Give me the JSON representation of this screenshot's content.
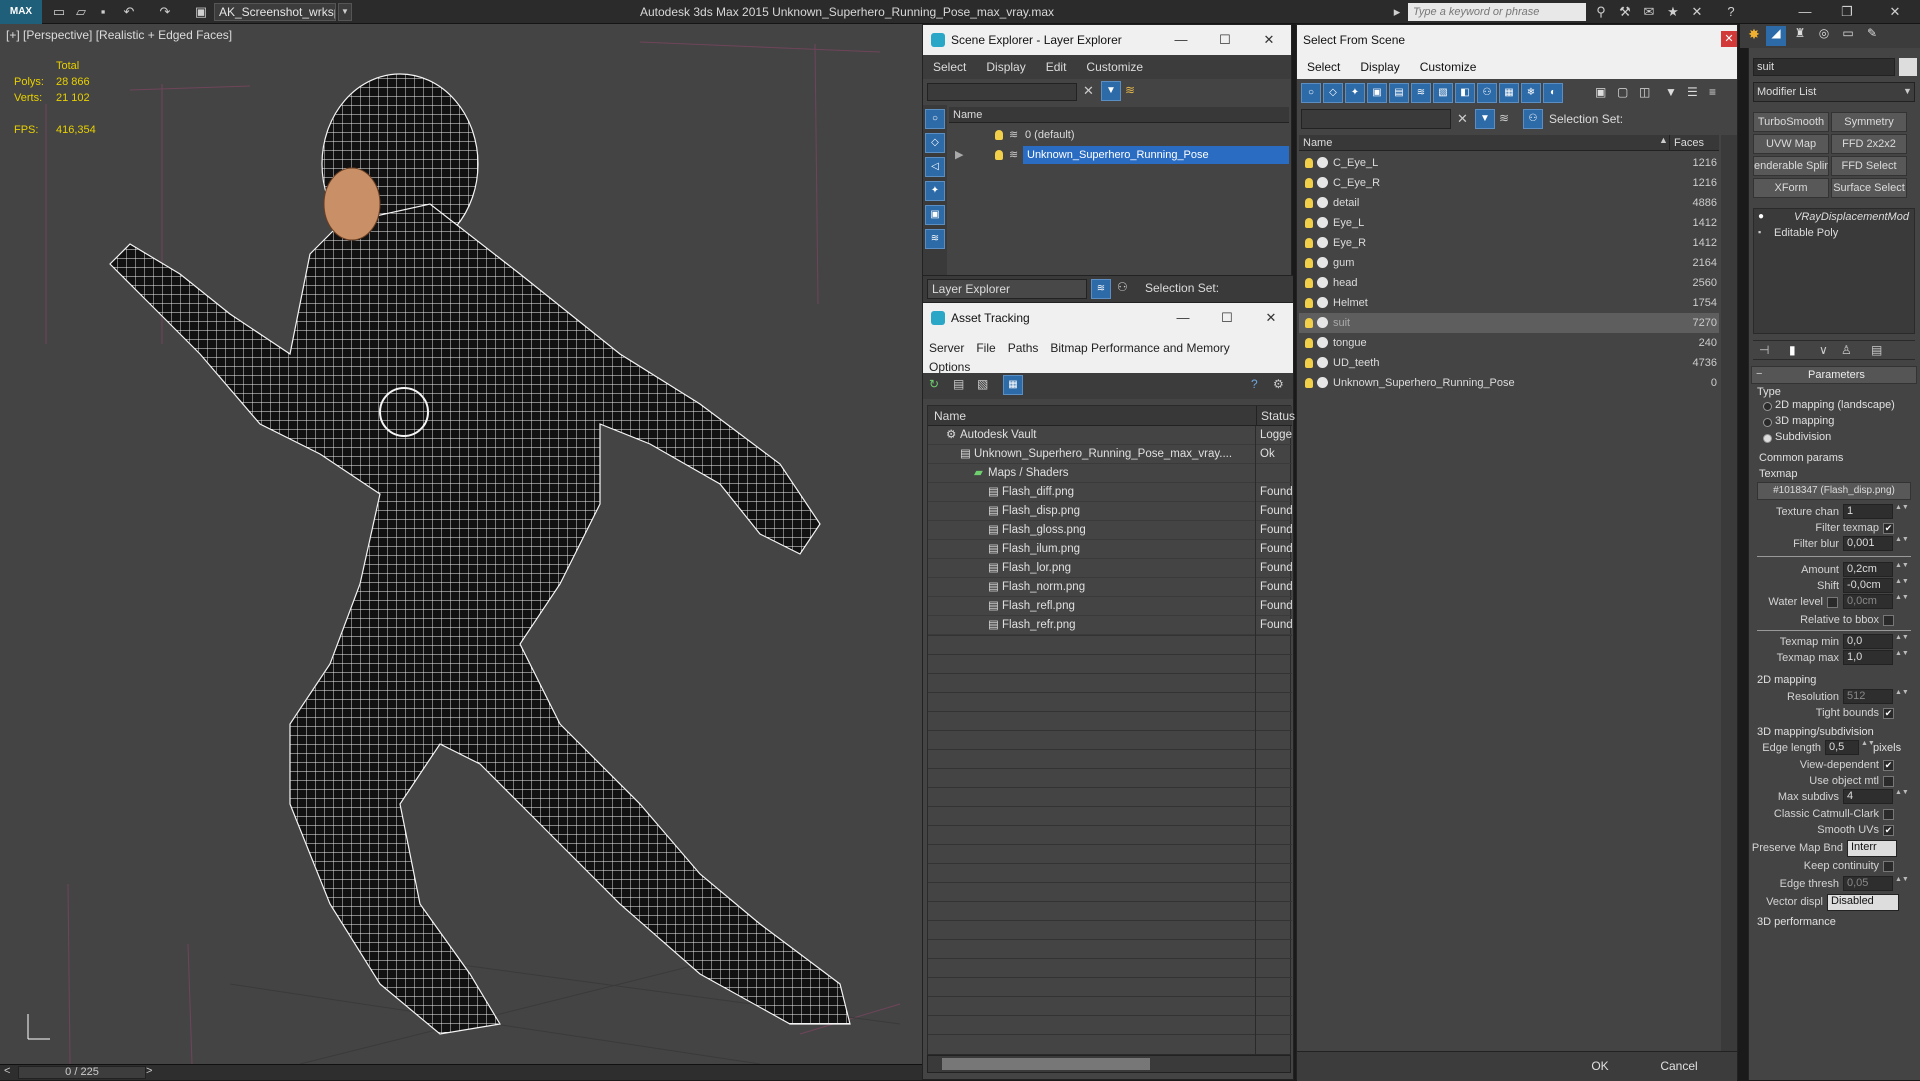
{
  "app": {
    "title": "Autodesk 3ds Max  2015    Unknown_Superhero_Running_Pose_max_vray.max",
    "workspace": "AK_Screenshot_wrksp",
    "search_placeholder": "Type a keyword or phrase",
    "logo": "MAX"
  },
  "viewport": {
    "label": "[+] [Perspective] [Realistic + Edged Faces]",
    "stats": {
      "total": "Total",
      "polys_label": "Polys:",
      "polys": "28 866",
      "verts_label": "Verts:",
      "verts": "21 102",
      "fps_label": "FPS:",
      "fps": "416,354"
    },
    "time": "0 / 225"
  },
  "scene_explorer": {
    "title": "Scene Explorer - Layer Explorer",
    "menu": [
      "Select",
      "Display",
      "Edit",
      "Customize"
    ],
    "col_name": "Name",
    "layers": [
      {
        "name": "0 (default)",
        "selected": false
      },
      {
        "name": "Unknown_Superhero_Running_Pose",
        "selected": true
      }
    ],
    "footer_label": "Layer Explorer",
    "selection_set": "Selection Set:"
  },
  "asset_tracking": {
    "title": "Asset Tracking",
    "menu": [
      "Server",
      "File",
      "Paths",
      "Bitmap Performance and Memory",
      "Options"
    ],
    "col_name": "Name",
    "col_status": "Status",
    "rows": [
      {
        "name": "Autodesk Vault",
        "status": "Logge",
        "indent": 1
      },
      {
        "name": "Unknown_Superhero_Running_Pose_max_vray....",
        "status": "Ok",
        "indent": 2
      },
      {
        "name": "Maps / Shaders",
        "status": "",
        "indent": 3
      },
      {
        "name": "Flash_diff.png",
        "status": "Found",
        "indent": 4
      },
      {
        "name": "Flash_disp.png",
        "status": "Found",
        "indent": 4
      },
      {
        "name": "Flash_gloss.png",
        "status": "Found",
        "indent": 4
      },
      {
        "name": "Flash_ilum.png",
        "status": "Found",
        "indent": 4
      },
      {
        "name": "Flash_lor.png",
        "status": "Found",
        "indent": 4
      },
      {
        "name": "Flash_norm.png",
        "status": "Found",
        "indent": 4
      },
      {
        "name": "Flash_refl.png",
        "status": "Found",
        "indent": 4
      },
      {
        "name": "Flash_refr.png",
        "status": "Found",
        "indent": 4
      }
    ]
  },
  "select_from_scene": {
    "title": "Select From Scene",
    "menu": [
      "Select",
      "Display",
      "Customize"
    ],
    "selection_set": "Selection Set:",
    "col_name": "Name",
    "col_faces": "Faces",
    "objects": [
      {
        "name": "C_Eye_L",
        "faces": "1216"
      },
      {
        "name": "C_Eye_R",
        "faces": "1216"
      },
      {
        "name": "detail",
        "faces": "4886"
      },
      {
        "name": "Eye_L",
        "faces": "1412"
      },
      {
        "name": "Eye_R",
        "faces": "1412"
      },
      {
        "name": "gum",
        "faces": "2164"
      },
      {
        "name": "head",
        "faces": "2560"
      },
      {
        "name": "Helmet",
        "faces": "1754"
      },
      {
        "name": "suit",
        "faces": "7270",
        "selected": true
      },
      {
        "name": "tongue",
        "faces": "240"
      },
      {
        "name": "UD_teeth",
        "faces": "4736"
      },
      {
        "name": "Unknown_Superhero_Running_Pose",
        "faces": "0"
      }
    ],
    "ok": "OK",
    "cancel": "Cancel"
  },
  "command_panel": {
    "object_name": "suit",
    "modifier_list": "Modifier List",
    "buttons": [
      "TurboSmooth",
      "Symmetry",
      "UVW Map",
      "FFD 2x2x2",
      "enderable Splin",
      "FFD Select",
      "XForm",
      "Surface Select"
    ],
    "stack": [
      "VRayDisplacementMod",
      "Editable Poly"
    ],
    "params": {
      "rollout": "Parameters",
      "type_label": "Type",
      "types": [
        "2D mapping (landscape)",
        "3D mapping",
        "Subdivision"
      ],
      "common": "Common params",
      "texmap_label": "Texmap",
      "texmap": "#1018347 (Flash_disp.png)",
      "texture_chan_label": "Texture chan",
      "texture_chan": "1",
      "filter_texmap": "Filter texmap",
      "filter_blur_label": "Filter blur",
      "filter_blur": "0,001",
      "amount_label": "Amount",
      "amount": "0,2cm",
      "shift_label": "Shift",
      "shift": "-0,0cm",
      "water_label": "Water level",
      "water": "0,0cm",
      "relative": "Relative to bbox",
      "tmin_label": "Texmap min",
      "tmin": "0,0",
      "tmax_label": "Texmap max",
      "tmax": "1,0",
      "sec2d": "2D mapping",
      "res_label": "Resolution",
      "res": "512",
      "tight": "Tight bounds",
      "sec3d": "3D mapping/subdivision",
      "edge_label": "Edge length",
      "edge": "0,5",
      "pixels": "pixels",
      "viewdep": "View-dependent",
      "useobj": "Use object mtl",
      "maxsub_label": "Max subdivs",
      "maxsub": "4",
      "catmull": "Classic Catmull-Clark",
      "smoothuv": "Smooth UVs",
      "preserve_label": "Preserve Map Bnd",
      "preserve": "Interr",
      "keepcont": "Keep continuity",
      "edgethr_label": "Edge thresh",
      "edgethr": "0,05",
      "vecdisp_label": "Vector displ",
      "vecdisp": "Disabled",
      "perf": "3D performance"
    }
  },
  "colors": {
    "accent": "#2c6aa8",
    "selected_row": "#2a6cc2",
    "stats": "#e8d000"
  }
}
